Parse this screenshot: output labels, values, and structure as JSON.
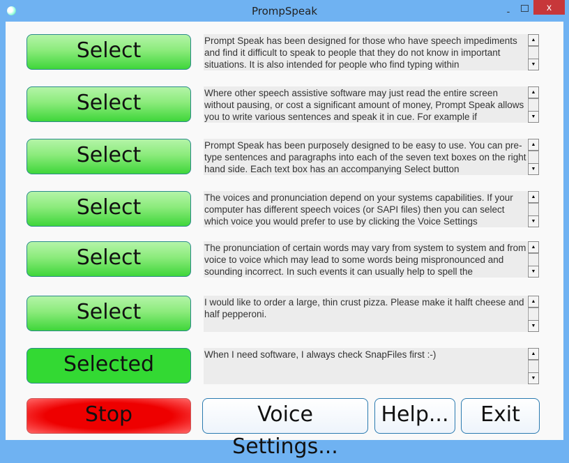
{
  "window": {
    "title": "PrompSpeak",
    "minimize": "-",
    "close": "x"
  },
  "rows": [
    {
      "button": "Select",
      "selected": false,
      "text": "Prompt Speak has been designed for those who have speech impediments and find it difficult to speak to people that they do not know in important situations. It is also intended for people who find typing within"
    },
    {
      "button": "Select",
      "selected": false,
      "text": "Where other speech assistive software may just read the entire screen without pausing, or cost a significant amount of money, Prompt Speak allows you to write various sentences and speak it in cue. For example if"
    },
    {
      "button": "Select",
      "selected": false,
      "text": "Prompt Speak has been purposely designed to be easy to use. You can pre-type sentences and paragraphs into each of the seven text boxes on the right hand side. Each text box has an accompanying Select button"
    },
    {
      "button": "Select",
      "selected": false,
      "text": "The voices and pronunciation depend on your systems capabilities. If your computer has different speech voices (or SAPI files) then you can select which voice you would prefer to use by clicking the Voice Settings"
    },
    {
      "button": "Select",
      "selected": false,
      "text": "The pronunciation of certain words may vary from system to system and from voice to voice which may lead to some words being mispronounced and sounding incorrect. In such events it can usually help to spell the"
    },
    {
      "button": "Select",
      "selected": false,
      "text": "I would like to order a large, thin crust pizza. Please make it halft cheese and half pepperoni."
    },
    {
      "button": "Selected",
      "selected": true,
      "text": "When I need software, I always check SnapFiles first :-)"
    }
  ],
  "bottom": {
    "stop": "Stop",
    "voice_settings": "Voice Settings...",
    "help": "Help...",
    "exit": "Exit"
  },
  "colors": {
    "select": "#8ceb7c",
    "selected": "#33d933",
    "stop": "#e00000",
    "close": "#c7373a"
  }
}
